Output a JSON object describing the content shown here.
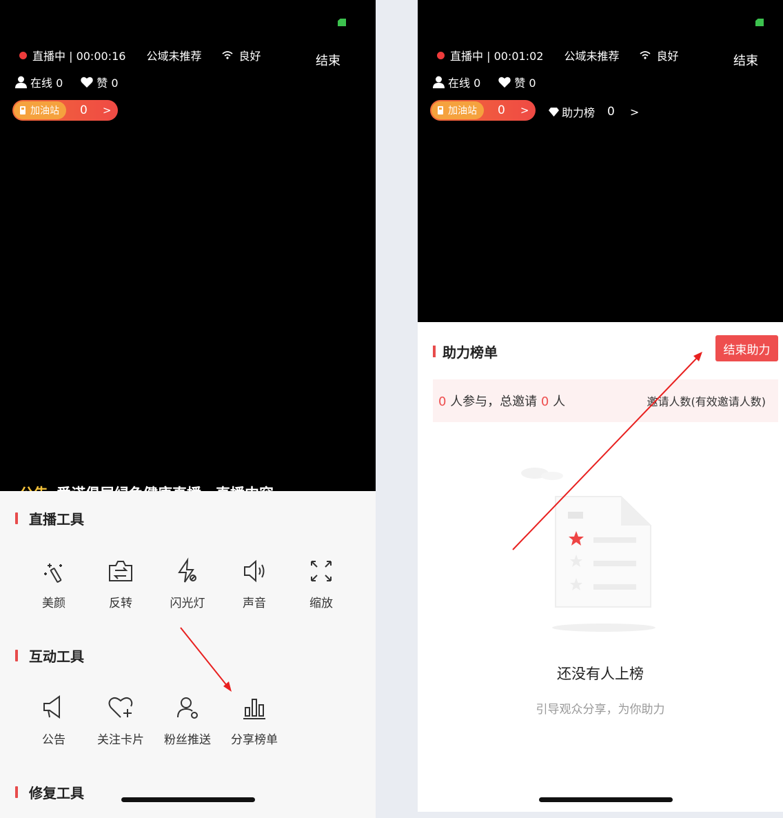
{
  "left": {
    "status": {
      "live_label": "直播中 | 00:00:16",
      "recommend": "公域未推荐",
      "network": "良好"
    },
    "end_label": "结束",
    "stats": {
      "online": "在线 0",
      "likes": "赞 0"
    },
    "fuel": {
      "label": "加油站",
      "count": "0",
      "arrow": ">"
    },
    "notice": {
      "prefix": "公告",
      "text": "爱诺俱层绿色健康直播，直播内容"
    },
    "sections": {
      "live_tools": "直播工具",
      "interactive_tools": "互动工具",
      "repair_tools": "修复工具"
    },
    "live_tools": [
      {
        "label": "美颜",
        "icon": "magic-wand-icon"
      },
      {
        "label": "反转",
        "icon": "camera-flip-icon"
      },
      {
        "label": "闪光灯",
        "icon": "flash-off-icon"
      },
      {
        "label": "声音",
        "icon": "speaker-icon"
      },
      {
        "label": "缩放",
        "icon": "expand-icon"
      }
    ],
    "interactive_tools": [
      {
        "label": "公告",
        "icon": "megaphone-icon"
      },
      {
        "label": "关注卡片",
        "icon": "heart-plus-icon"
      },
      {
        "label": "粉丝推送",
        "icon": "user-push-icon"
      },
      {
        "label": "分享榜单",
        "icon": "bar-chart-icon"
      }
    ]
  },
  "right": {
    "status": {
      "live_label": "直播中 | 00:01:02",
      "recommend": "公域未推荐",
      "network": "良好"
    },
    "end_label": "结束",
    "stats": {
      "online": "在线 0",
      "likes": "赞 0"
    },
    "fuel": {
      "label": "加油站",
      "count": "0",
      "arrow": ">"
    },
    "rank_chip": {
      "label": "助力榜",
      "count": "0",
      "arrow": ">"
    },
    "rank_title": "助力榜单",
    "stop_button": "结束助力",
    "summary": {
      "participants": "0",
      "participants_suffix": "人参与，总邀请",
      "invites": "0",
      "invites_suffix": "人",
      "right_label": "邀请人数(有效邀请人数)"
    },
    "empty": {
      "title": "还没有人上榜",
      "subtitle": "引导观众分享，为你助力"
    }
  },
  "colors": {
    "accent_red": "#ee4e4e",
    "live_dot": "#ee3b3b",
    "fuel_orange": "#f26a3a"
  }
}
